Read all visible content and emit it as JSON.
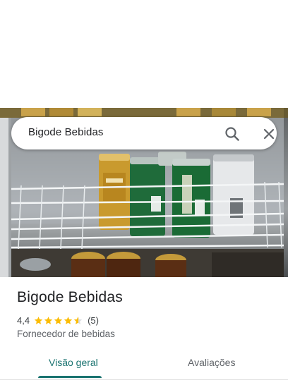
{
  "search": {
    "query": "Bigode Bebidas"
  },
  "icons": {
    "search": "search-icon",
    "close": "close-icon",
    "star": "star-icon"
  },
  "photo": {
    "description_icon": "place-photo"
  },
  "place": {
    "name": "Bigode Bebidas",
    "rating_text": "4,4",
    "rating_value": 4.4,
    "review_count_text": "(5)",
    "category": "Fornecedor de bebidas"
  },
  "tabs": [
    {
      "label": "Visão geral",
      "selected": true
    },
    {
      "label": "Avaliações",
      "selected": false
    }
  ],
  "colors": {
    "accent": "#1a7370",
    "star": "#fbbc04",
    "text_primary": "#202124",
    "text_secondary": "#5f6368"
  }
}
